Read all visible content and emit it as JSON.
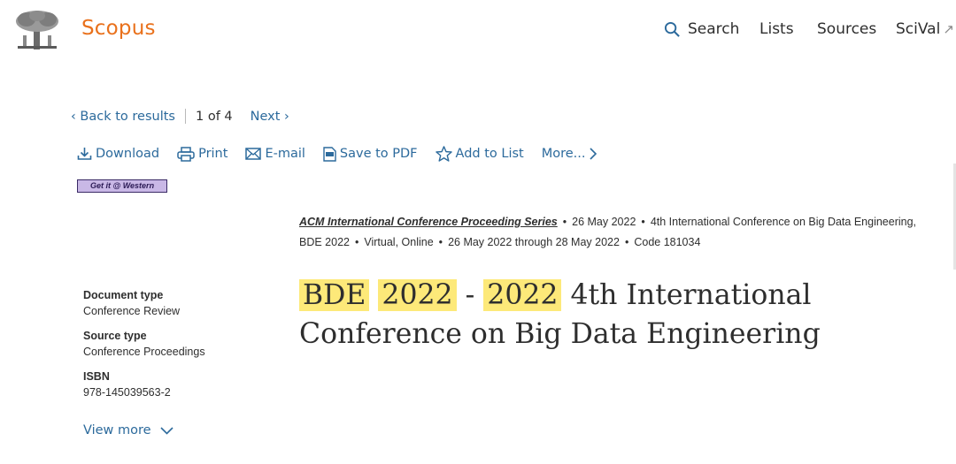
{
  "header": {
    "brand": "Scopus",
    "nav": {
      "search": "Search",
      "lists": "Lists",
      "sources": "Sources",
      "scival": "SciVal",
      "scival_external": "↗"
    }
  },
  "pager": {
    "back": "Back to results",
    "position": "1",
    "of_label": "of",
    "total": "4",
    "next": "Next"
  },
  "toolbar": {
    "download": "Download",
    "print": "Print",
    "email": "E-mail",
    "save_pdf": "Save to PDF",
    "add_list": "Add to List",
    "more": "More..."
  },
  "getit_badge": "Get it @ Western",
  "source": {
    "series": "ACM International Conference Proceeding Series",
    "date": "26 May 2022",
    "conference": "4th International Conference on Big Data Engineering,",
    "conf_short": "BDE 2022",
    "location": "Virtual, Online",
    "dates_range": "26 May 2022 through 28 May 2022",
    "code": "Code 181034"
  },
  "title": {
    "hl1": "BDE",
    "hl2": "2022",
    "dash": "-",
    "hl3": "2022",
    "rest": "4th International Conference on Big Data Engineering"
  },
  "meta": {
    "doc_type_label": "Document type",
    "doc_type": "Conference Review",
    "source_type_label": "Source type",
    "source_type": "Conference Proceedings",
    "isbn_label": "ISBN",
    "isbn": "978-145039563-2",
    "view_more": "View more"
  },
  "colors": {
    "brand": "#e9711c",
    "link": "#2c6a9c",
    "highlight": "#fde979"
  }
}
